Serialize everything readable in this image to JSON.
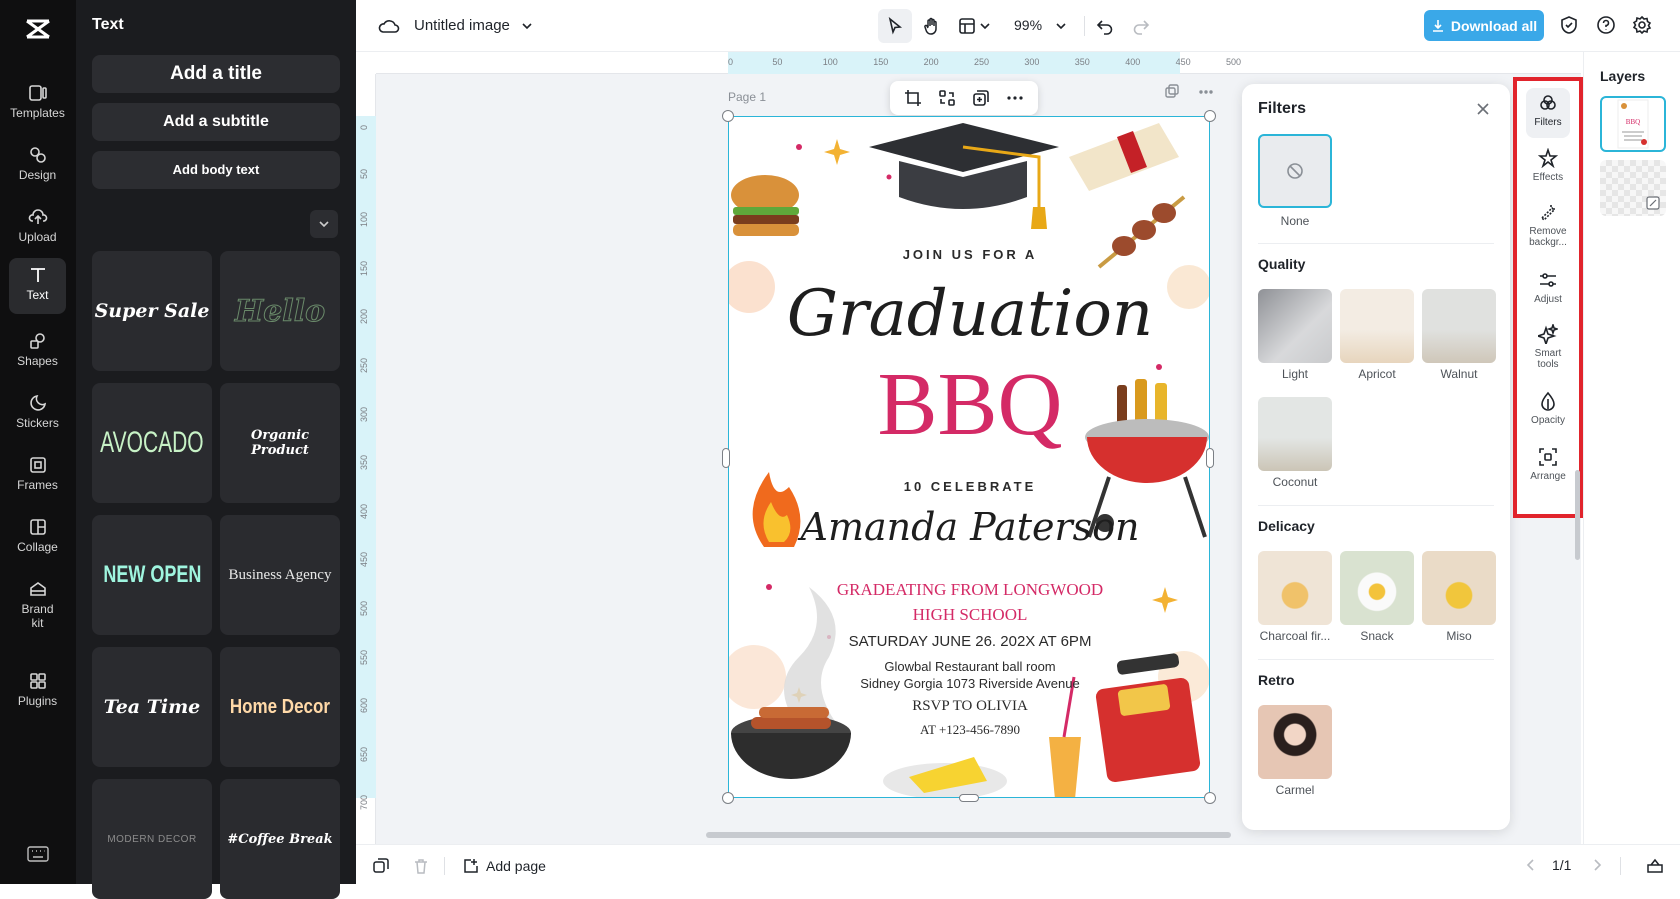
{
  "rail": {
    "items": [
      {
        "label": "Templates",
        "icon": "templates-icon"
      },
      {
        "label": "Design",
        "icon": "design-icon"
      },
      {
        "label": "Upload",
        "icon": "upload-icon"
      },
      {
        "label": "Text",
        "icon": "text-icon"
      },
      {
        "label": "Shapes",
        "icon": "shapes-icon"
      },
      {
        "label": "Stickers",
        "icon": "stickers-icon"
      },
      {
        "label": "Frames",
        "icon": "frames-icon"
      },
      {
        "label": "Collage",
        "icon": "collage-icon"
      },
      {
        "label": "Brand kit",
        "icon": "brand-kit-icon"
      },
      {
        "label": "Plugins",
        "icon": "plugins-icon"
      }
    ]
  },
  "text_panel": {
    "title": "Text",
    "add_title": "Add a title",
    "add_subtitle": "Add a subtitle",
    "add_body": "Add body text",
    "presets": [
      "Super Sale",
      "Hello",
      "AVOCADO",
      "Organic Product",
      "NEW OPEN",
      "Business Agency",
      "Tea Time",
      "Home Decor",
      "MODERN DECOR",
      "#Coffee Break"
    ]
  },
  "topbar": {
    "doc_title": "Untitled image",
    "zoom": "99%",
    "download_label": "Download all"
  },
  "ruler": {
    "h_ticks": [
      "0",
      "50",
      "100",
      "150",
      "200",
      "250",
      "300",
      "350",
      "400",
      "450",
      "500"
    ],
    "v_ticks": [
      "0",
      "50",
      "100",
      "150",
      "200",
      "250",
      "300",
      "350",
      "400",
      "450",
      "500",
      "550",
      "600",
      "650",
      "700"
    ]
  },
  "canvas": {
    "page_label": "Page 1"
  },
  "invitation": {
    "line1": "JOIN US FOR A",
    "line2": "Graduation",
    "line3": "BBQ",
    "line4": "10 CELEBRATE",
    "line5": "Amanda Paterson",
    "line6": "GRADEATING FROM LONGWOOD",
    "line7": "HIGH SCHOOL",
    "line8": "SATURDAY JUNE 26. 202X AT 6PM",
    "line9": "Glowbal Restaurant ball room",
    "line10": "Sidney Gorgia 1073 Riverside Avenue",
    "line11": "RSVP TO OLIVIA",
    "line12": "AT +123-456-7890",
    "accent_color": "#d42a66"
  },
  "filters": {
    "title": "Filters",
    "none_label": "None",
    "sections": [
      {
        "title": "Quality",
        "items": [
          "Light",
          "Apricot",
          "Walnut",
          "Coconut"
        ]
      },
      {
        "title": "Delicacy",
        "items": [
          "Charcoal fir...",
          "Snack",
          "Miso"
        ]
      },
      {
        "title": "Retro",
        "items": [
          "Carmel"
        ]
      }
    ]
  },
  "tools": [
    {
      "label": "Filters",
      "icon": "filters-icon"
    },
    {
      "label": "Effects",
      "icon": "effects-icon"
    },
    {
      "label": "Remove backgr...",
      "icon": "remove-background-icon"
    },
    {
      "label": "Adjust",
      "icon": "adjust-icon"
    },
    {
      "label": "Smart tools",
      "icon": "smart-tools-icon"
    },
    {
      "label": "Opacity",
      "icon": "opacity-icon"
    },
    {
      "label": "Arrange",
      "icon": "arrange-icon"
    }
  ],
  "layers": {
    "title": "Layers"
  },
  "bottombar": {
    "add_page": "Add page",
    "page_count": "1/1"
  },
  "colors": {
    "accent_blue": "#3aa8e8",
    "selection": "#2bb5d8",
    "highlight_box": "#e1242c"
  }
}
